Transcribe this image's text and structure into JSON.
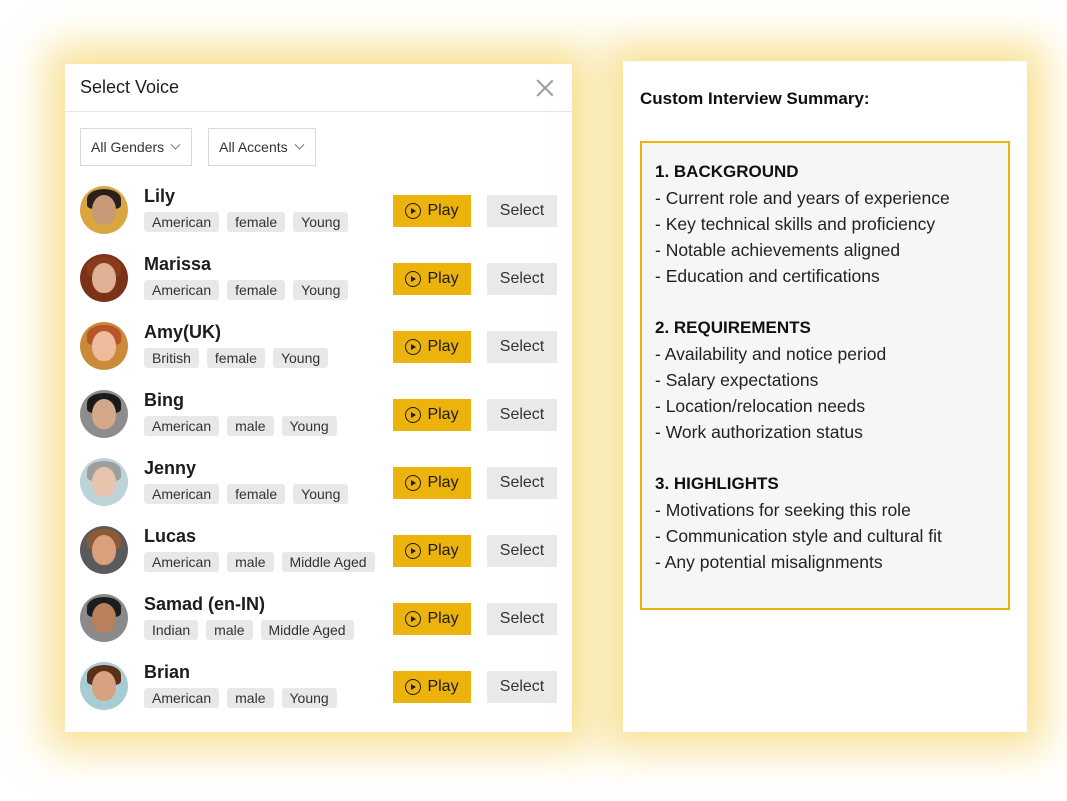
{
  "voice_dialog": {
    "title": "Select Voice",
    "filters": {
      "gender": "All Genders",
      "accent": "All Accents"
    },
    "play_label": "Play",
    "select_label": "Select",
    "voices": [
      {
        "name": "Lily",
        "tags": [
          "American",
          "female",
          "Young"
        ],
        "skin": "#c99a78",
        "hair": "#2a1f1a",
        "bg": "#d9a640"
      },
      {
        "name": "Marissa",
        "tags": [
          "American",
          "female",
          "Young"
        ],
        "skin": "#e0b094",
        "hair": "#8a3a1c",
        "bg": "#7a3218"
      },
      {
        "name": "Amy(UK)",
        "tags": [
          "British",
          "female",
          "Young"
        ],
        "skin": "#eebc9c",
        "hair": "#b5562a",
        "bg": "#c98a3a"
      },
      {
        "name": "Bing",
        "tags": [
          "American",
          "male",
          "Young"
        ],
        "skin": "#d4a888",
        "hair": "#1a1a1a",
        "bg": "#8d8d8d"
      },
      {
        "name": "Jenny",
        "tags": [
          "American",
          "female",
          "Young"
        ],
        "skin": "#e6c4ae",
        "hair": "#9e9e9e",
        "bg": "#bcd3d8"
      },
      {
        "name": "Lucas",
        "tags": [
          "American",
          "male",
          "Middle Aged"
        ],
        "skin": "#d9a07e",
        "hair": "#8a5a34",
        "bg": "#5a5a5a"
      },
      {
        "name": "Samad (en-IN)",
        "tags": [
          "Indian",
          "male",
          "Middle Aged"
        ],
        "skin": "#b8805c",
        "hair": "#1c1c1c",
        "bg": "#8a8a8a"
      },
      {
        "name": "Brian",
        "tags": [
          "American",
          "male",
          "Young"
        ],
        "skin": "#d8a282",
        "hair": "#5a3018",
        "bg": "#a8ccd4"
      }
    ]
  },
  "summary": {
    "title": "Custom Interview Summary:",
    "sections": [
      {
        "heading": "1. BACKGROUND",
        "items": [
          "- Current role and years of experience",
          "- Key technical skills and proficiency",
          "- Notable achievements aligned",
          "- Education and certifications"
        ]
      },
      {
        "heading": "2. REQUIREMENTS",
        "items": [
          "- Availability and notice period",
          "- Salary expectations",
          "- Location/relocation needs",
          "- Work authorization status"
        ]
      },
      {
        "heading": "3. HIGHLIGHTS",
        "items": [
          "- Motivations for seeking this role",
          "- Communication style and cultural fit",
          "- Any potential misalignments"
        ]
      }
    ]
  },
  "colors": {
    "accent": "#ebb30c",
    "glow": "#f2c83c",
    "select_bg": "#e9e9ec",
    "tag_bg": "#e8e8e8",
    "summary_bg": "#f6f6f6"
  }
}
